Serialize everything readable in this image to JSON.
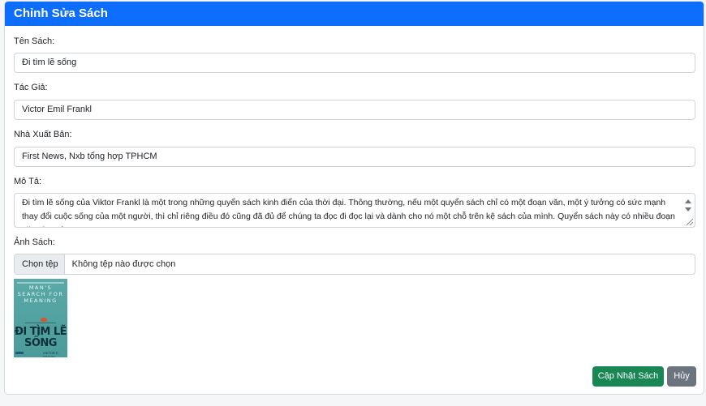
{
  "header": {
    "title": "Chỉnh Sửa Sách"
  },
  "form": {
    "title_label": "Tên Sách:",
    "title_value": "Đi tìm lẽ sống",
    "author_label": "Tác Giả:",
    "author_value": "Victor Emil Frankl",
    "publisher_label": "Nhà Xuất Bản:",
    "publisher_value": "First News, Nxb tổng hợp TPHCM",
    "description_label": "Mô Tả:",
    "description_value": "Đi tìm lẽ sống của Viktor Frankl là một trong những quyển sách kinh điển của thời đại. Thông thường, nếu một quyển sách chỉ có một đoạn văn, một ý tưởng có sức mạnh thay đổi cuộc sống của một người, thì chỉ riêng điều đó cũng đã đủ để chúng ta đọc đi đọc lại và dành cho nó một chỗ trên kệ sách của mình. Quyển sách này có nhiều đoạn văn như vậy.",
    "image_label": "Ảnh Sách:",
    "file_button": "Chọn tệp",
    "file_status": "Không tệp nào được chọn"
  },
  "cover": {
    "top_title": "MAN'S SEARCH FOR MEANING",
    "main_title": "ĐI TÌM LẼ SỐNG",
    "author": "VIKTOR E. FRANKL"
  },
  "actions": {
    "save_label": "Cập Nhật Sách",
    "cancel_label": "Hủy"
  },
  "colors": {
    "header": "#0d6efd",
    "save": "#198754",
    "cancel": "#6c757d"
  }
}
